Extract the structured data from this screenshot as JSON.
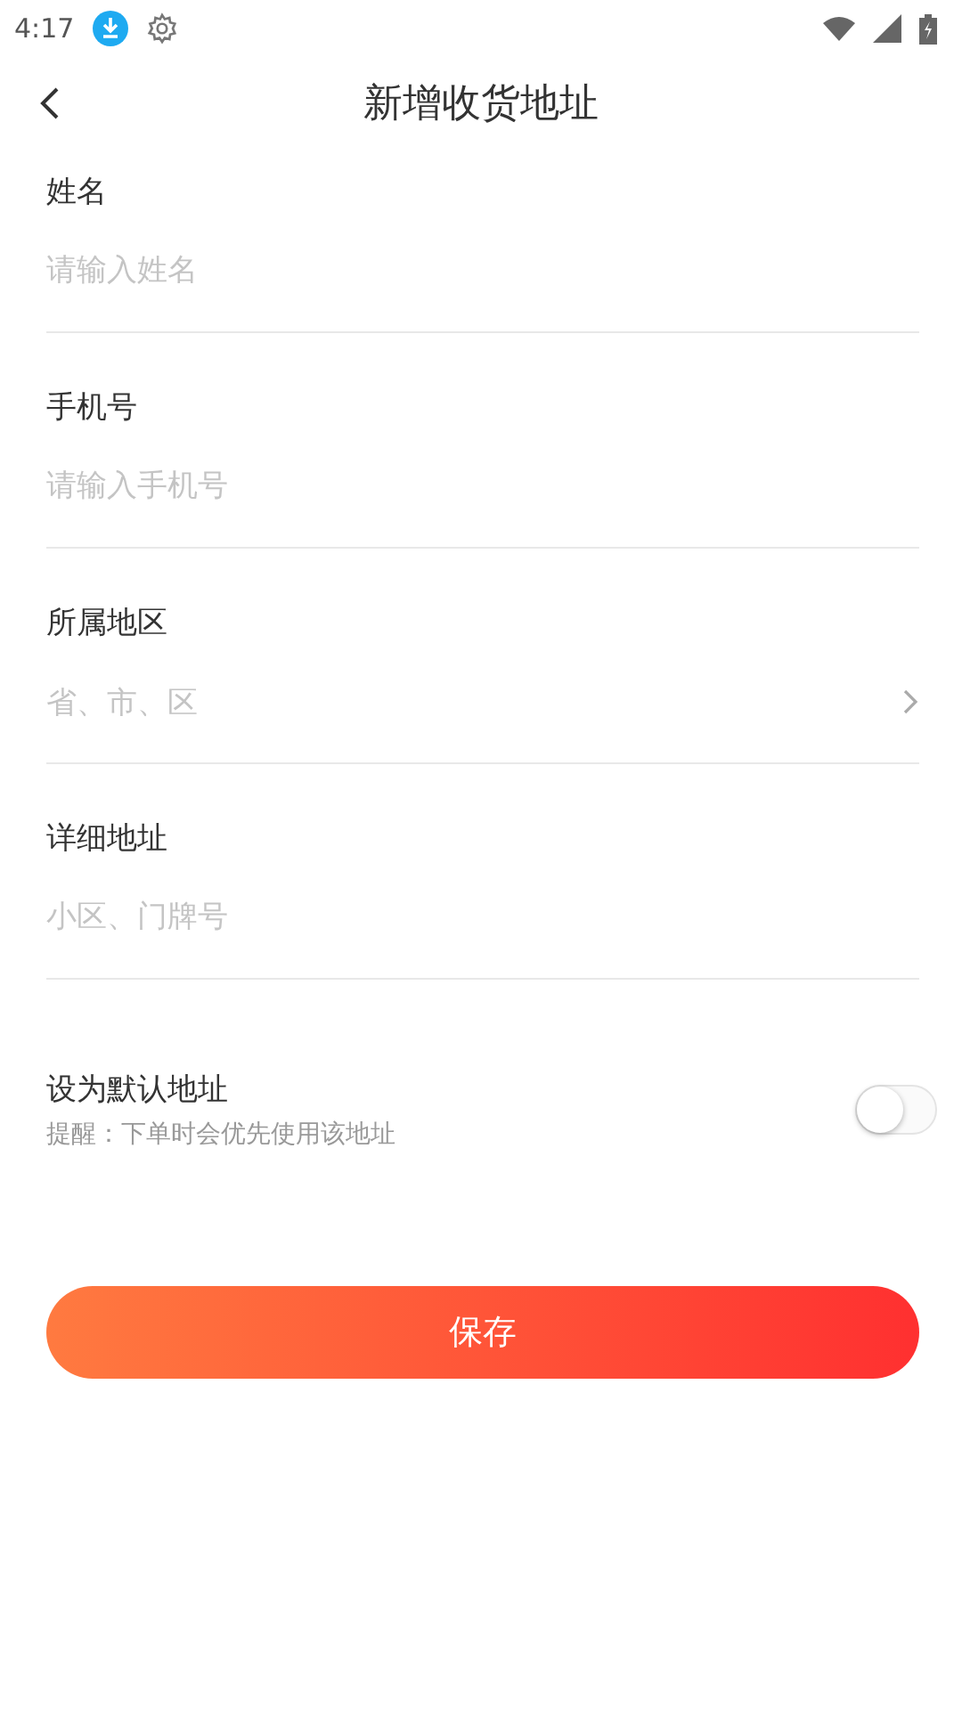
{
  "status_bar": {
    "time": "4:17"
  },
  "header": {
    "title": "新增收货地址"
  },
  "fields": [
    {
      "kind": "input",
      "label": "姓名",
      "placeholder": "请输入姓名"
    },
    {
      "kind": "input",
      "label": "手机号",
      "placeholder": "请输入手机号"
    },
    {
      "kind": "select",
      "label": "所属地区",
      "placeholder": "省、市、区"
    },
    {
      "kind": "input",
      "label": "详细地址",
      "placeholder": "小区、门牌号"
    }
  ],
  "default_address": {
    "label": "设为默认地址",
    "hint": "提醒：下单时会优先使用该地址",
    "on": false
  },
  "save_button": {
    "label": "保存"
  }
}
